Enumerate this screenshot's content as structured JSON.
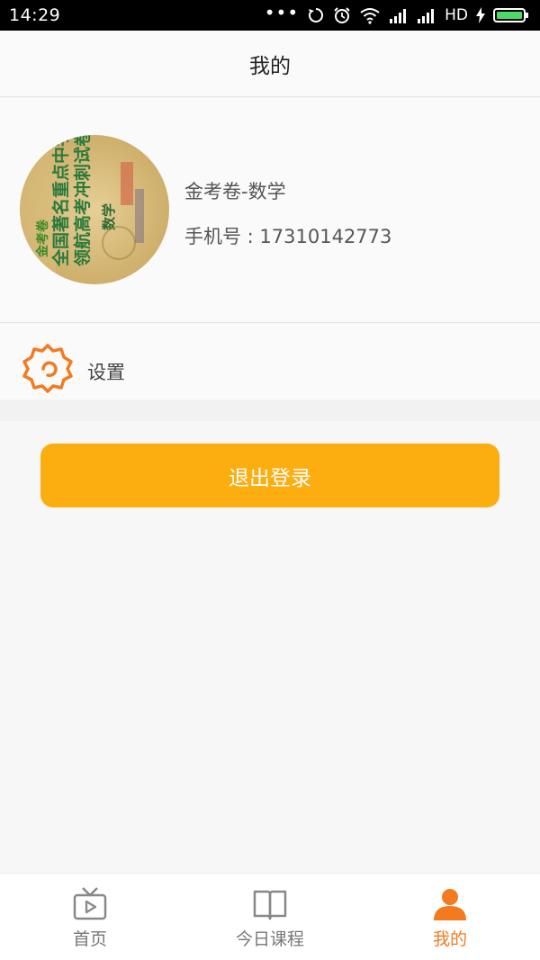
{
  "status_bar": {
    "time": "14:29",
    "dots": "•••",
    "network": "HD",
    "icons": [
      "sync-icon",
      "alarm-icon",
      "wifi-icon",
      "signal-icon",
      "signal-icon",
      "charging-icon",
      "battery-icon"
    ]
  },
  "header": {
    "title": "我的"
  },
  "profile": {
    "name": "金考卷-数学",
    "phone": "手机号 : 17310142773",
    "avatar_text": {
      "line1": "全国著名重点中学",
      "line2": "领航高考冲刺试卷",
      "series": "金考卷",
      "subject": "数学"
    }
  },
  "settings": {
    "label": "设置",
    "icon": "gear-icon"
  },
  "logout": {
    "label": "退出登录"
  },
  "tabbar": {
    "items": [
      {
        "label": "首页",
        "icon": "tv-icon",
        "active": false
      },
      {
        "label": "今日课程",
        "icon": "book-icon",
        "active": false
      },
      {
        "label": "我的",
        "icon": "person-icon",
        "active": true
      }
    ]
  },
  "colors": {
    "accent": "#fcad10",
    "active_tab": "#f47a1f",
    "gear": "#f47a1f",
    "background": "#f7f7f7"
  }
}
